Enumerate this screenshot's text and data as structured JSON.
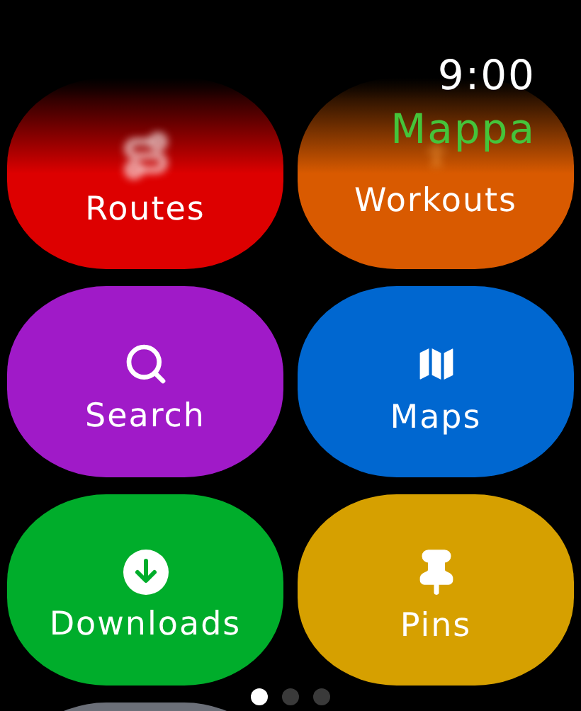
{
  "header": {
    "time": "9:00",
    "app_name": "Mappa"
  },
  "tiles": [
    {
      "label": "Routes",
      "color": "#dd0000",
      "faded": true
    },
    {
      "label": "Workouts",
      "color": "#d95a00",
      "faded": true
    },
    {
      "label": "Search",
      "color": "#a01ac8",
      "faded": false
    },
    {
      "label": "Maps",
      "color": "#0067d0",
      "faded": false
    },
    {
      "label": "Downloads",
      "color": "#00ad2b",
      "faded": false
    },
    {
      "label": "Pins",
      "color": "#d6a000",
      "faded": false
    },
    {
      "color": "#6b6f78"
    }
  ],
  "pages": [
    {
      "selected": true
    },
    {
      "selected": false
    },
    {
      "selected": false
    }
  ]
}
